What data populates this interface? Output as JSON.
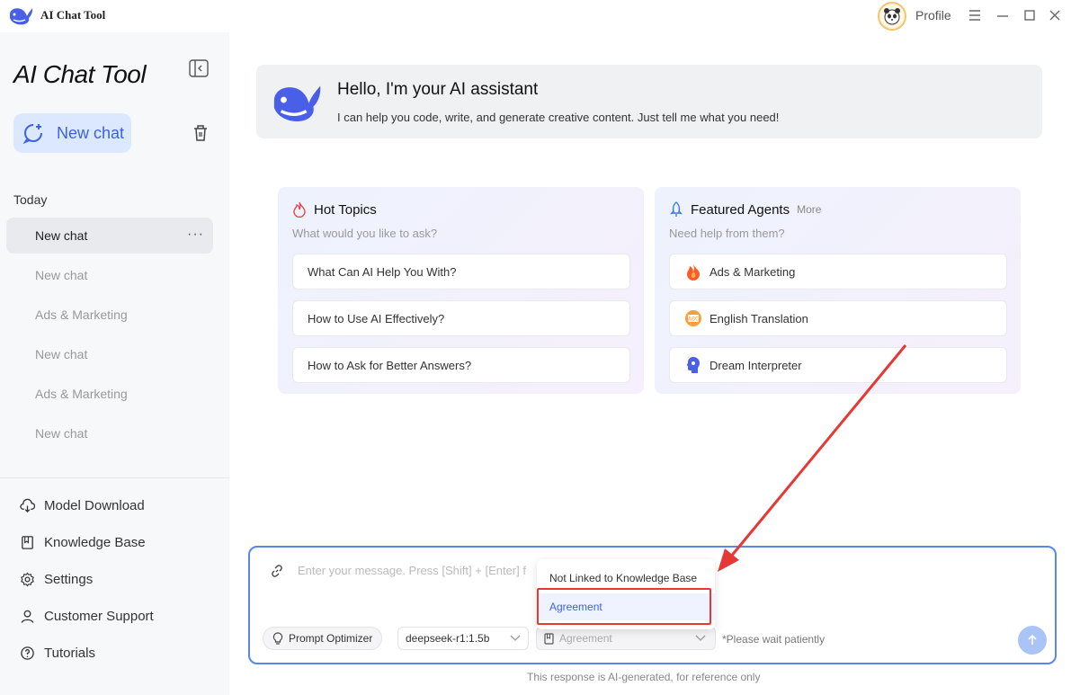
{
  "titlebar": {
    "app_name": "AI Chat Tool",
    "profile_label": "Profile"
  },
  "sidebar": {
    "title": "AI Chat Tool",
    "new_chat_label": "New chat",
    "group_label": "Today",
    "chats": [
      {
        "label": "New chat",
        "active": true
      },
      {
        "label": "New chat",
        "active": false
      },
      {
        "label": "Ads & Marketing",
        "active": false
      },
      {
        "label": "New chat",
        "active": false
      },
      {
        "label": "Ads & Marketing",
        "active": false
      },
      {
        "label": "New chat",
        "active": false
      }
    ],
    "more_dots": "···",
    "menu": [
      {
        "label": "Model Download",
        "icon": "cloud-download-icon"
      },
      {
        "label": "Knowledge Base",
        "icon": "book-icon"
      },
      {
        "label": "Settings",
        "icon": "gear-icon"
      },
      {
        "label": "Customer Support",
        "icon": "user-icon"
      },
      {
        "label": "Tutorials",
        "icon": "help-circle-icon"
      }
    ]
  },
  "welcome": {
    "title": "Hello, I'm your AI assistant",
    "subtitle": "I can help you code, write, and generate creative content. Just tell me what you need!"
  },
  "hot_topics": {
    "title": "Hot Topics",
    "subtitle": "What would you like to ask?",
    "items": [
      "What Can AI Help You With?",
      "How to Use AI Effectively?",
      "How to Ask for Better Answers?"
    ]
  },
  "featured_agents": {
    "title": "Featured Agents",
    "more_label": "More",
    "subtitle": "Need help from them?",
    "items": [
      {
        "label": "Ads & Marketing",
        "icon": "flame-icon"
      },
      {
        "label": "English Translation",
        "icon": "translate-icon"
      },
      {
        "label": "Dream Interpreter",
        "icon": "head-icon"
      }
    ]
  },
  "input": {
    "placeholder": "Enter your message. Press [Shift] + [Enter] f",
    "prompt_optimizer_label": "Prompt Optimizer",
    "model_value": "deepseek-r1:1.5b",
    "kb_value": "Agreement",
    "wait_text": "*Please wait patiently"
  },
  "dropdown": {
    "options": [
      {
        "label": "Not Linked to Knowledge Base",
        "selected": false
      },
      {
        "label": "Agreement",
        "selected": true
      }
    ]
  },
  "disclaimer": "This response is AI-generated, for reference only",
  "colors": {
    "accent": "#3d63e0",
    "highlight": "#e53935"
  }
}
